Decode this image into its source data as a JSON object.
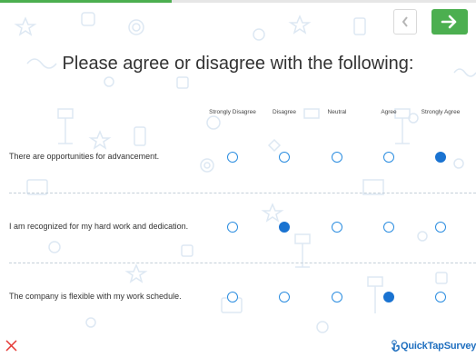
{
  "progress": {
    "fraction": 0.36,
    "color": "#4caf50"
  },
  "navigation": {
    "prev_icon": "chevron-left-icon",
    "next_icon": "arrow-right-icon",
    "next_color": "#4caf50"
  },
  "question": {
    "title": "Please agree or disagree with the following:"
  },
  "scale": {
    "columns": [
      "Strongly Disagree",
      "Disagree",
      "Neutral",
      "Agree",
      "Strongly Agree"
    ]
  },
  "rows": [
    {
      "label": "There are opportunities for advancement.",
      "selected_index": 4
    },
    {
      "label": "I am recognized for my hard work and dedication.",
      "selected_index": 1
    },
    {
      "label": "The company is flexible with my work schedule.",
      "selected_index": 3
    }
  ],
  "footer": {
    "close_icon": "close-icon",
    "brand_icon": "tap-icon",
    "brand_name": "QuickTapSurvey"
  },
  "colors": {
    "accent": "#4caf50",
    "radio_border": "#2b8de0",
    "radio_selected": "#1a73d1",
    "close": "#e53935",
    "brand": "#1f6fbf"
  }
}
